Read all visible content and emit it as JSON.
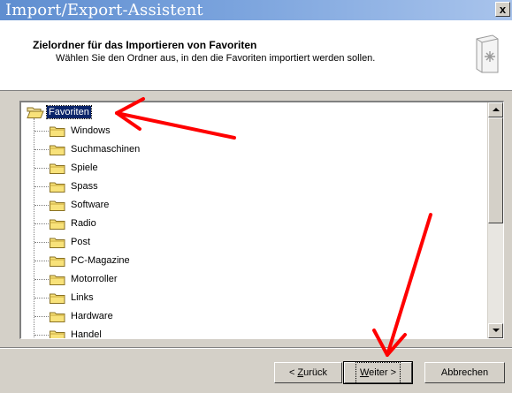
{
  "window": {
    "title": "Import/Export-Assistent",
    "close_label": "x"
  },
  "header": {
    "title": "Zielordner für das Importieren von Favoriten",
    "subtitle": "Wählen Sie den Ordner aus, in den die Favoriten importiert werden sollen."
  },
  "tree": {
    "root": {
      "label": "Favoriten",
      "selected": true
    },
    "children": [
      {
        "label": "Windows"
      },
      {
        "label": "Suchmaschinen"
      },
      {
        "label": "Spiele"
      },
      {
        "label": "Spass"
      },
      {
        "label": "Software"
      },
      {
        "label": "Radio"
      },
      {
        "label": "Post"
      },
      {
        "label": "PC-Magazine"
      },
      {
        "label": "Motorroller"
      },
      {
        "label": "Links"
      },
      {
        "label": "Hardware"
      },
      {
        "label": "Handel"
      }
    ]
  },
  "buttons": {
    "back": {
      "prefix": "< ",
      "mnemonic": "Z",
      "rest": "urück"
    },
    "next": {
      "mnemonic": "W",
      "rest": "eiter",
      "suffix": " >"
    },
    "cancel": "Abbrechen"
  },
  "annotation": {
    "color": "#ff0000"
  },
  "icons": [
    "folder-open-icon",
    "folder-icon",
    "wizard-book-icon",
    "scroll-up-arrow-icon",
    "scroll-down-arrow-icon",
    "red-arrow-annotation"
  ]
}
